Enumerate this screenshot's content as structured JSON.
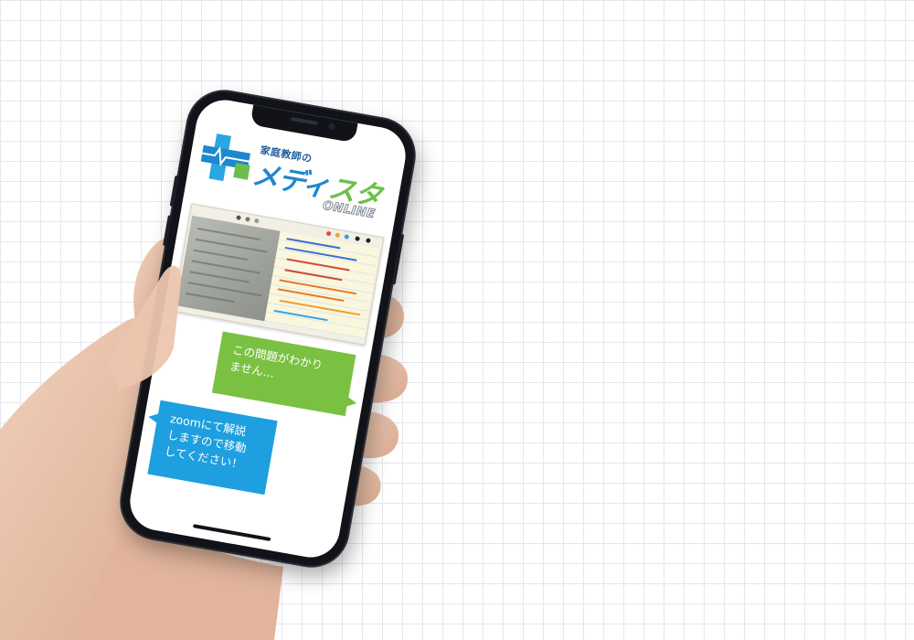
{
  "logo": {
    "subtitle": "家庭教師の",
    "name_part_blue": "メディ",
    "name_part_green": "スタ",
    "tag": "ONLINE"
  },
  "chat": {
    "student_message": "この問題がわかり\nません…",
    "tutor_message": "zoomにて解説\nしますので移動\nしてください！"
  },
  "colors": {
    "brand_blue": "#1e88cf",
    "brand_green": "#6cc04a",
    "student_bubble": "#7ac142",
    "tutor_bubble": "#1d9fe0"
  }
}
